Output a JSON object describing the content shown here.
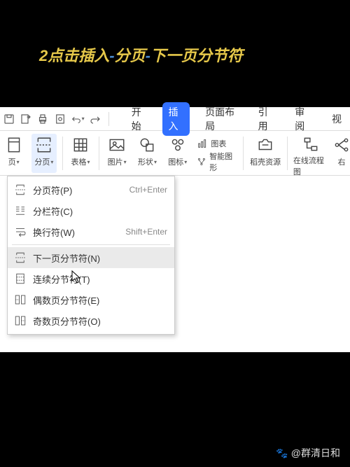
{
  "caption": {
    "step": "2",
    "part1": "点击插入",
    "dash1": "-",
    "part2": "分页",
    "dash2": "-",
    "part3": "下一页分节符"
  },
  "tabs": {
    "start": "开始",
    "insert": "插入",
    "layout": "页面布局",
    "ref": "引用",
    "review": "审阅",
    "view": "视"
  },
  "ribbon": {
    "cover": "页",
    "page_break": "分页",
    "table": "表格",
    "picture": "图片",
    "shape": "形状",
    "icon": "图标",
    "chart": "图表",
    "smartart": "智能图形",
    "assets": "稻壳资源",
    "flowchart": "在线流程图",
    "extra": "右"
  },
  "menu": {
    "page_break": {
      "label": "分页符(P)",
      "shortcut": "Ctrl+Enter"
    },
    "column_break": {
      "label": "分栏符(C)"
    },
    "text_wrap": {
      "label": "换行符(W)",
      "shortcut": "Shift+Enter"
    },
    "next_page": {
      "label": "下一页分节符(N)"
    },
    "continuous": {
      "label": "连续分节符(T)"
    },
    "even_page": {
      "label": "偶数页分节符(E)"
    },
    "odd_page": {
      "label": "奇数页分节符(O)"
    }
  },
  "watermark": {
    "author": "@群清日和"
  }
}
